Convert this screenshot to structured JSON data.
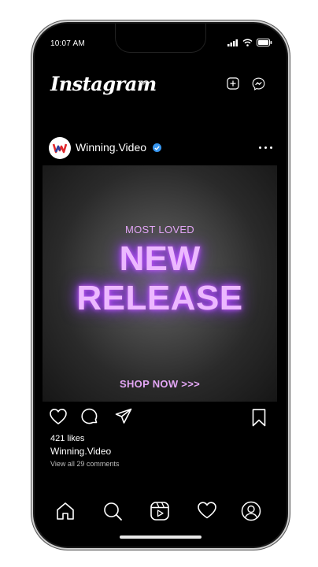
{
  "status": {
    "time": "10:07 AM"
  },
  "header": {
    "logo": "Instagram"
  },
  "post": {
    "username": "Winning.Video",
    "image": {
      "eyebrow": "MOST LOVED",
      "headline_1": "NEW",
      "headline_2": "RELEASE",
      "cta": "SHOP NOW >>>"
    },
    "likes": "421 likes",
    "caption_user": "Winning.Video",
    "comments_link": "View all 29 comments"
  },
  "icons": {
    "status": [
      "signal-icon",
      "wifi-icon",
      "battery-icon"
    ],
    "header": [
      "new-post-icon",
      "messenger-icon"
    ],
    "actions": [
      "heart-icon",
      "comment-icon",
      "share-icon",
      "bookmark-icon"
    ],
    "tabbar": [
      "home-icon",
      "search-icon",
      "reels-icon",
      "activity-icon",
      "profile-icon"
    ]
  },
  "colors": {
    "accent": "#ecb8ff",
    "glow": "#9b3cff",
    "verified": "#3897f0"
  }
}
